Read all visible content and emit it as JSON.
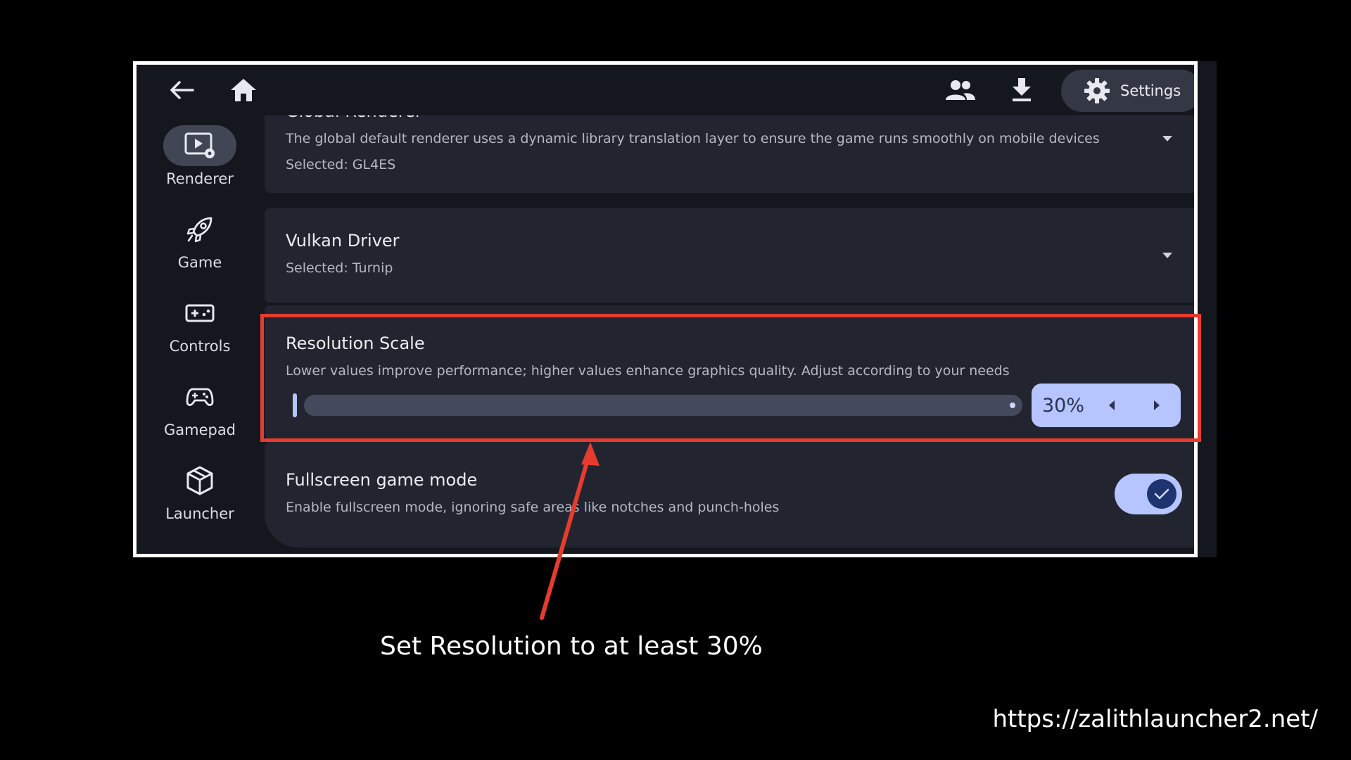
{
  "topbar": {
    "settings_label": "Settings"
  },
  "sidebar": {
    "items": [
      {
        "label": "Renderer",
        "icon": "renderer-icon",
        "active": true
      },
      {
        "label": "Game",
        "icon": "rocket-icon",
        "active": false
      },
      {
        "label": "Controls",
        "icon": "controls-icon",
        "active": false
      },
      {
        "label": "Gamepad",
        "icon": "gamepad-icon",
        "active": false
      },
      {
        "label": "Launcher",
        "icon": "cube-icon",
        "active": false
      }
    ]
  },
  "settings": {
    "global_renderer": {
      "title": "Global Renderer",
      "description": "The global default renderer uses a dynamic library translation layer to ensure the game runs smoothly on mobile devices",
      "selected": "Selected: GL4ES"
    },
    "vulkan_driver": {
      "title": "Vulkan Driver",
      "selected": "Selected: Turnip"
    },
    "resolution_scale": {
      "title": "Resolution Scale",
      "description": "Lower values improve performance; higher values enhance graphics quality. Adjust according to your needs",
      "value_label": "30%"
    },
    "fullscreen": {
      "title": "Fullscreen game mode",
      "description": "Enable fullscreen mode, ignoring safe areas like notches and punch-holes",
      "enabled": true
    }
  },
  "annotation": {
    "caption": "Set Resolution to at least 30%",
    "url": "https://zalithlauncher2.net/",
    "highlight_color": "#e63b2e"
  },
  "colors": {
    "accent": "#b6c5ff",
    "card": "#22252f",
    "background": "#15171f"
  }
}
